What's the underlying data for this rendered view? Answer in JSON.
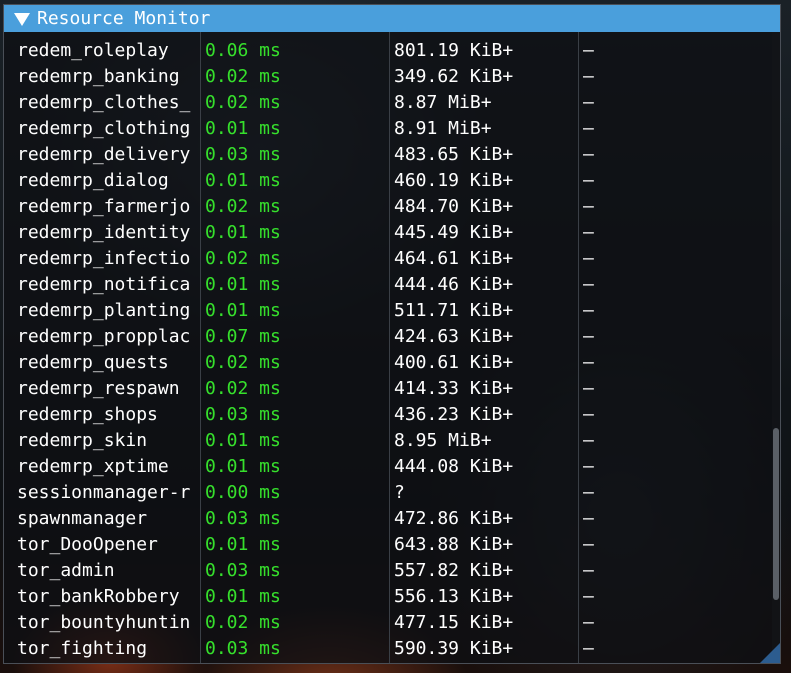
{
  "window": {
    "title": "Resource Monitor"
  },
  "rows": [
    {
      "name": "redem_roleplay",
      "cpu": "0.06 ms",
      "memory": "801.19 KiB+",
      "extra": "–"
    },
    {
      "name": "redemrp_banking",
      "cpu": "0.02 ms",
      "memory": "349.62 KiB+",
      "extra": "–"
    },
    {
      "name": "redemrp_clothes_",
      "cpu": "0.02 ms",
      "memory": "8.87 MiB+",
      "extra": "–"
    },
    {
      "name": "redemrp_clothing",
      "cpu": "0.01 ms",
      "memory": "8.91 MiB+",
      "extra": "–"
    },
    {
      "name": "redemrp_delivery",
      "cpu": "0.03 ms",
      "memory": "483.65 KiB+",
      "extra": "–"
    },
    {
      "name": "redemrp_dialog",
      "cpu": "0.01 ms",
      "memory": "460.19 KiB+",
      "extra": "–"
    },
    {
      "name": "redemrp_farmerjo",
      "cpu": "0.02 ms",
      "memory": "484.70 KiB+",
      "extra": "–"
    },
    {
      "name": "redemrp_identity",
      "cpu": "0.01 ms",
      "memory": "445.49 KiB+",
      "extra": "–"
    },
    {
      "name": "redemrp_infectio",
      "cpu": "0.02 ms",
      "memory": "464.61 KiB+",
      "extra": "–"
    },
    {
      "name": "redemrp_notifica",
      "cpu": "0.01 ms",
      "memory": "444.46 KiB+",
      "extra": "–"
    },
    {
      "name": "redemrp_planting",
      "cpu": "0.01 ms",
      "memory": "511.71 KiB+",
      "extra": "–"
    },
    {
      "name": "redemrp_propplac",
      "cpu": "0.07 ms",
      "memory": "424.63 KiB+",
      "extra": "–"
    },
    {
      "name": "redemrp_quests",
      "cpu": "0.02 ms",
      "memory": "400.61 KiB+",
      "extra": "–"
    },
    {
      "name": "redemrp_respawn",
      "cpu": "0.02 ms",
      "memory": "414.33 KiB+",
      "extra": "–"
    },
    {
      "name": "redemrp_shops",
      "cpu": "0.03 ms",
      "memory": "436.23 KiB+",
      "extra": "–"
    },
    {
      "name": "redemrp_skin",
      "cpu": "0.01 ms",
      "memory": "8.95 MiB+",
      "extra": "–"
    },
    {
      "name": "redemrp_xptime",
      "cpu": "0.01 ms",
      "memory": "444.08 KiB+",
      "extra": "–"
    },
    {
      "name": "sessionmanager-r",
      "cpu": "0.00 ms",
      "memory": "?",
      "extra": "–"
    },
    {
      "name": "spawnmanager",
      "cpu": "0.03 ms",
      "memory": "472.86 KiB+",
      "extra": "–"
    },
    {
      "name": "tor_DooOpener",
      "cpu": "0.01 ms",
      "memory": "643.88 KiB+",
      "extra": "–"
    },
    {
      "name": "tor_admin",
      "cpu": "0.03 ms",
      "memory": "557.82 KiB+",
      "extra": "–"
    },
    {
      "name": "tor_bankRobbery",
      "cpu": "0.01 ms",
      "memory": "556.13 KiB+",
      "extra": "–"
    },
    {
      "name": "tor_bountyhuntin",
      "cpu": "0.02 ms",
      "memory": "477.15 KiB+",
      "extra": "–"
    },
    {
      "name": "tor_fighting",
      "cpu": "0.03 ms",
      "memory": "590.39 KiB+",
      "extra": "–"
    }
  ],
  "colors": {
    "titlebar": "#4a9fdc",
    "cpu_text": "#36e02c",
    "text": "#ffffff"
  }
}
